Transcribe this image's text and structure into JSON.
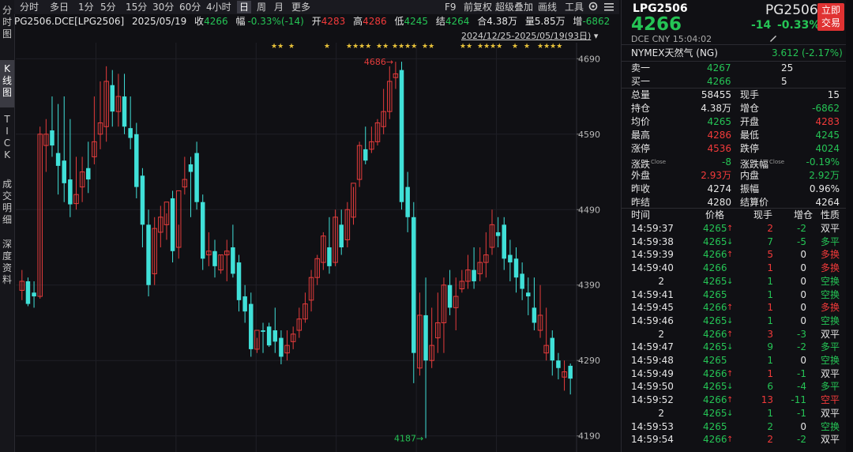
{
  "left_tabs": [
    {
      "label": "分时\n图",
      "active": false
    },
    {
      "label": "K线\n图",
      "active": true
    },
    {
      "label": "T\nI\nC\nK",
      "active": false
    },
    {
      "label": "成交\n明细",
      "active": false
    },
    {
      "label": "深度\n资料",
      "active": false
    }
  ],
  "toolbar": {
    "periods": [
      "分时",
      "多日",
      "1分",
      "5分",
      "15分",
      "30分",
      "60分",
      "4小时",
      "日",
      "周",
      "月",
      "更多"
    ],
    "active_period": "日",
    "right_items": [
      "F9",
      "前复权",
      "超级叠加",
      "画线",
      "工具"
    ]
  },
  "info": {
    "symbol": "PG2506.DCE[LPG2506]",
    "date": "2025/05/19",
    "close_label": "收",
    "close": "4266",
    "change_label": "幅",
    "change": "-0.33%(-14)",
    "open_label": "开",
    "open": "4283",
    "high_label": "高",
    "high": "4286",
    "low_label": "低",
    "low": "4245",
    "settle_label": "结",
    "settle": "4264",
    "oi_label": "合",
    "oi": "4.38万",
    "vol_label": "量",
    "vol": "5.85万",
    "incr_label": "增",
    "incr": "-6862"
  },
  "range_text": "2024/12/25-2025/05/19(93日)",
  "chart_data": {
    "type": "candlestick",
    "y_ticks": [
      4690,
      4590,
      4490,
      4390,
      4290,
      4190
    ],
    "ylim": [
      4175,
      4705
    ],
    "max_label": "4686",
    "min_label": "4187",
    "candles": [
      [
        4383,
        4410,
        4395,
        4370
      ],
      [
        4395,
        4400,
        4365,
        4362
      ],
      [
        4380,
        4395,
        4375,
        4360
      ],
      [
        4375,
        4600,
        4590,
        4372
      ],
      [
        4575,
        4610,
        4590,
        4540
      ],
      [
        4595,
        4640,
        4575,
        4560
      ],
      [
        4565,
        4630,
        4548,
        4510
      ],
      [
        4555,
        4640,
        4525,
        4500
      ],
      [
        4530,
        4610,
        4497,
        4480
      ],
      [
        4498,
        4560,
        4510,
        4490
      ],
      [
        4520,
        4560,
        4540,
        4500
      ],
      [
        4545,
        4580,
        4530,
        4512
      ],
      [
        4560,
        4640,
        4580,
        4550
      ],
      [
        4590,
        4660,
        4605,
        4570
      ],
      [
        4600,
        4680,
        4660,
        4580
      ],
      [
        4655,
        4675,
        4620,
        4600
      ],
      [
        4620,
        4670,
        4640,
        4600
      ],
      [
        4640,
        4670,
        4600,
        4590
      ],
      [
        4598,
        4640,
        4585,
        4570
      ],
      [
        4590,
        4605,
        4520,
        4505
      ],
      [
        4535,
        4545,
        4470,
        4440
      ],
      [
        4470,
        4490,
        4390,
        4375
      ],
      [
        4405,
        4480,
        4465,
        4390
      ],
      [
        4460,
        4495,
        4480,
        4440
      ],
      [
        4470,
        4485,
        4500,
        4450
      ],
      [
        4505,
        4515,
        4435,
        4420
      ],
      [
        4440,
        4470,
        4515,
        4425
      ],
      [
        4520,
        4560,
        4530,
        4510
      ],
      [
        4550,
        4560,
        4540,
        4480
      ],
      [
        4565,
        4580,
        4500,
        4490
      ],
      [
        4500,
        4510,
        4425,
        4410
      ],
      [
        4430,
        4460,
        4435,
        4415
      ],
      [
        4435,
        4450,
        4415,
        4400
      ],
      [
        4410,
        4430,
        4430,
        4405
      ],
      [
        4430,
        4450,
        4435,
        4395
      ],
      [
        4440,
        4470,
        4405,
        4400
      ],
      [
        4420,
        4430,
        4370,
        4355
      ],
      [
        4375,
        4390,
        4355,
        4340
      ],
      [
        4365,
        4380,
        4305,
        4295
      ],
      [
        4305,
        4320,
        4330,
        4300
      ],
      [
        4330,
        4340,
        4328,
        4300
      ],
      [
        4335,
        4340,
        4310,
        4308
      ],
      [
        4330,
        4360,
        4315,
        4300
      ],
      [
        4320,
        4330,
        4295,
        4285
      ],
      [
        4300,
        4330,
        4310,
        4290
      ],
      [
        4315,
        4335,
        4325,
        4305
      ],
      [
        4330,
        4360,
        4345,
        4320
      ],
      [
        4345,
        4380,
        4365,
        4340
      ],
      [
        4370,
        4410,
        4400,
        4355
      ],
      [
        4400,
        4430,
        4425,
        4390
      ],
      [
        4420,
        4460,
        4455,
        4410
      ],
      [
        4440,
        4480,
        4415,
        4405
      ],
      [
        4420,
        4490,
        4480,
        4415
      ],
      [
        4470,
        4490,
        4440,
        4430
      ],
      [
        4450,
        4500,
        4490,
        4440
      ],
      [
        4480,
        4520,
        4525,
        4470
      ],
      [
        4530,
        4580,
        4575,
        4520
      ],
      [
        4570,
        4600,
        4555,
        4550
      ],
      [
        4570,
        4600,
        4580,
        4565
      ],
      [
        4580,
        4610,
        4605,
        4575
      ],
      [
        4600,
        4650,
        4620,
        4590
      ],
      [
        4620,
        4680,
        4660,
        4610
      ],
      [
        4665,
        4686,
        4670,
        4650
      ],
      [
        4675,
        4686,
        4500,
        4490
      ],
      [
        4520,
        4540,
        4480,
        4460
      ],
      [
        4480,
        4500,
        4300,
        4260
      ],
      [
        4280,
        4380,
        4350,
        4270
      ],
      [
        4350,
        4400,
        4290,
        4187
      ],
      [
        4290,
        4360,
        4310,
        4280
      ],
      [
        4320,
        4380,
        4340,
        4300
      ],
      [
        4340,
        4400,
        4390,
        4300
      ],
      [
        4390,
        4410,
        4360,
        4350
      ],
      [
        4360,
        4400,
        4375,
        4330
      ],
      [
        4385,
        4410,
        4395,
        4380
      ],
      [
        4395,
        4430,
        4410,
        4385
      ],
      [
        4410,
        4440,
        4395,
        4385
      ],
      [
        4405,
        4440,
        4420,
        4395
      ],
      [
        4420,
        4460,
        4430,
        4400
      ],
      [
        4440,
        4490,
        4470,
        4430
      ],
      [
        4460,
        4480,
        4455,
        4440
      ],
      [
        4470,
        4480,
        4425,
        4410
      ],
      [
        4430,
        4450,
        4420,
        4395
      ],
      [
        4425,
        4440,
        4400,
        4380
      ],
      [
        4405,
        4420,
        4385,
        4370
      ],
      [
        4380,
        4400,
        4375,
        4350
      ],
      [
        4360,
        4400,
        4340,
        4330
      ],
      [
        4330,
        4390,
        4350,
        4320
      ],
      [
        4300,
        4360,
        4310,
        4290
      ],
      [
        4320,
        4330,
        4290,
        4270
      ],
      [
        4290,
        4300,
        4280,
        4265
      ],
      [
        4268,
        4290,
        4275,
        4250
      ],
      [
        4283,
        4286,
        4266,
        4245
      ]
    ],
    "stars": [
      "★★",
      "★",
      "★",
      "★★★★",
      "★★",
      "★★★★",
      "★★",
      "★★",
      "★★★★",
      "★",
      "★",
      "★★★★"
    ]
  },
  "right": {
    "code": "LPG2506",
    "contract": "PG2506",
    "price": "4266",
    "change": "-14",
    "change_pct": "-0.33%",
    "exchange": "DCE  CNY  15:04:02",
    "trade_btn": "立即\n交易",
    "nymex": {
      "name": "NYMEX天然气 (NG)",
      "price": "3.612",
      "pct": "(-2.17%)"
    },
    "book": [
      {
        "label": "卖一",
        "price": "4267",
        "qty": "25"
      },
      {
        "label": "买一",
        "price": "4266",
        "qty": "5"
      }
    ],
    "stats": [
      [
        "总量",
        "58455",
        "white",
        "现手",
        "15",
        "white"
      ],
      [
        "持仓",
        "4.38万",
        "white",
        "增仓",
        "-6862",
        "green"
      ],
      [
        "均价",
        "4265",
        "green",
        "开盘",
        "4283",
        "red"
      ],
      [
        "最高",
        "4286",
        "red",
        "最低",
        "4245",
        "green"
      ],
      [
        "涨停",
        "4536",
        "red",
        "跌停",
        "4024",
        "green"
      ],
      [
        "涨跌",
        "-8",
        "green",
        "涨跌幅",
        "-0.19%",
        "green"
      ],
      [
        "外盘",
        "2.93万",
        "red",
        "内盘",
        "2.92万",
        "green"
      ],
      [
        "昨收",
        "4274",
        "white",
        "振幅",
        "0.96%",
        "white"
      ],
      [
        "昨结",
        "4280",
        "white",
        "结算价",
        "4264",
        "white"
      ]
    ],
    "close_tag": "Close",
    "trade_headers": [
      "时间",
      "价格",
      "现手",
      "增仓",
      "性质"
    ],
    "trades": [
      [
        "14:59:37",
        "4265",
        "up",
        "2",
        "-2",
        "双平",
        "red",
        "white"
      ],
      [
        "14:59:38",
        "4265",
        "down",
        "7",
        "-5",
        "多平",
        "green",
        "green"
      ],
      [
        "14:59:39",
        "4266",
        "up",
        "5",
        "0",
        "多换",
        "red",
        "red"
      ],
      [
        "14:59:40",
        "4266",
        "",
        "1",
        "0",
        "多换",
        "red",
        "red"
      ],
      [
        "2",
        "4265",
        "down",
        "1",
        "0",
        "空换",
        "green",
        "green"
      ],
      [
        "14:59:41",
        "4265",
        "",
        "1",
        "0",
        "空换",
        "green",
        "green"
      ],
      [
        "14:59:45",
        "4266",
        "up",
        "1",
        "0",
        "多换",
        "red",
        "red"
      ],
      [
        "14:59:46",
        "4265",
        "down",
        "1",
        "0",
        "空换",
        "green",
        "green"
      ],
      [
        "2",
        "4266",
        "up",
        "3",
        "-3",
        "双平",
        "red",
        "white"
      ],
      [
        "14:59:47",
        "4265",
        "down",
        "9",
        "-2",
        "多平",
        "green",
        "green"
      ],
      [
        "14:59:48",
        "4265",
        "",
        "1",
        "0",
        "空换",
        "green",
        "green"
      ],
      [
        "14:59:49",
        "4266",
        "up",
        "1",
        "-1",
        "双平",
        "red",
        "white"
      ],
      [
        "14:59:50",
        "4265",
        "down",
        "6",
        "-4",
        "多平",
        "green",
        "green"
      ],
      [
        "14:59:52",
        "4266",
        "up",
        "13",
        "-11",
        "空平",
        "red",
        "red"
      ],
      [
        "2",
        "4265",
        "down",
        "1",
        "-1",
        "双平",
        "green",
        "white"
      ],
      [
        "14:59:53",
        "4265",
        "",
        "2",
        "0",
        "空换",
        "green",
        "green"
      ],
      [
        "14:59:54",
        "4266",
        "up",
        "2",
        "-2",
        "双平",
        "red",
        "white"
      ]
    ]
  }
}
